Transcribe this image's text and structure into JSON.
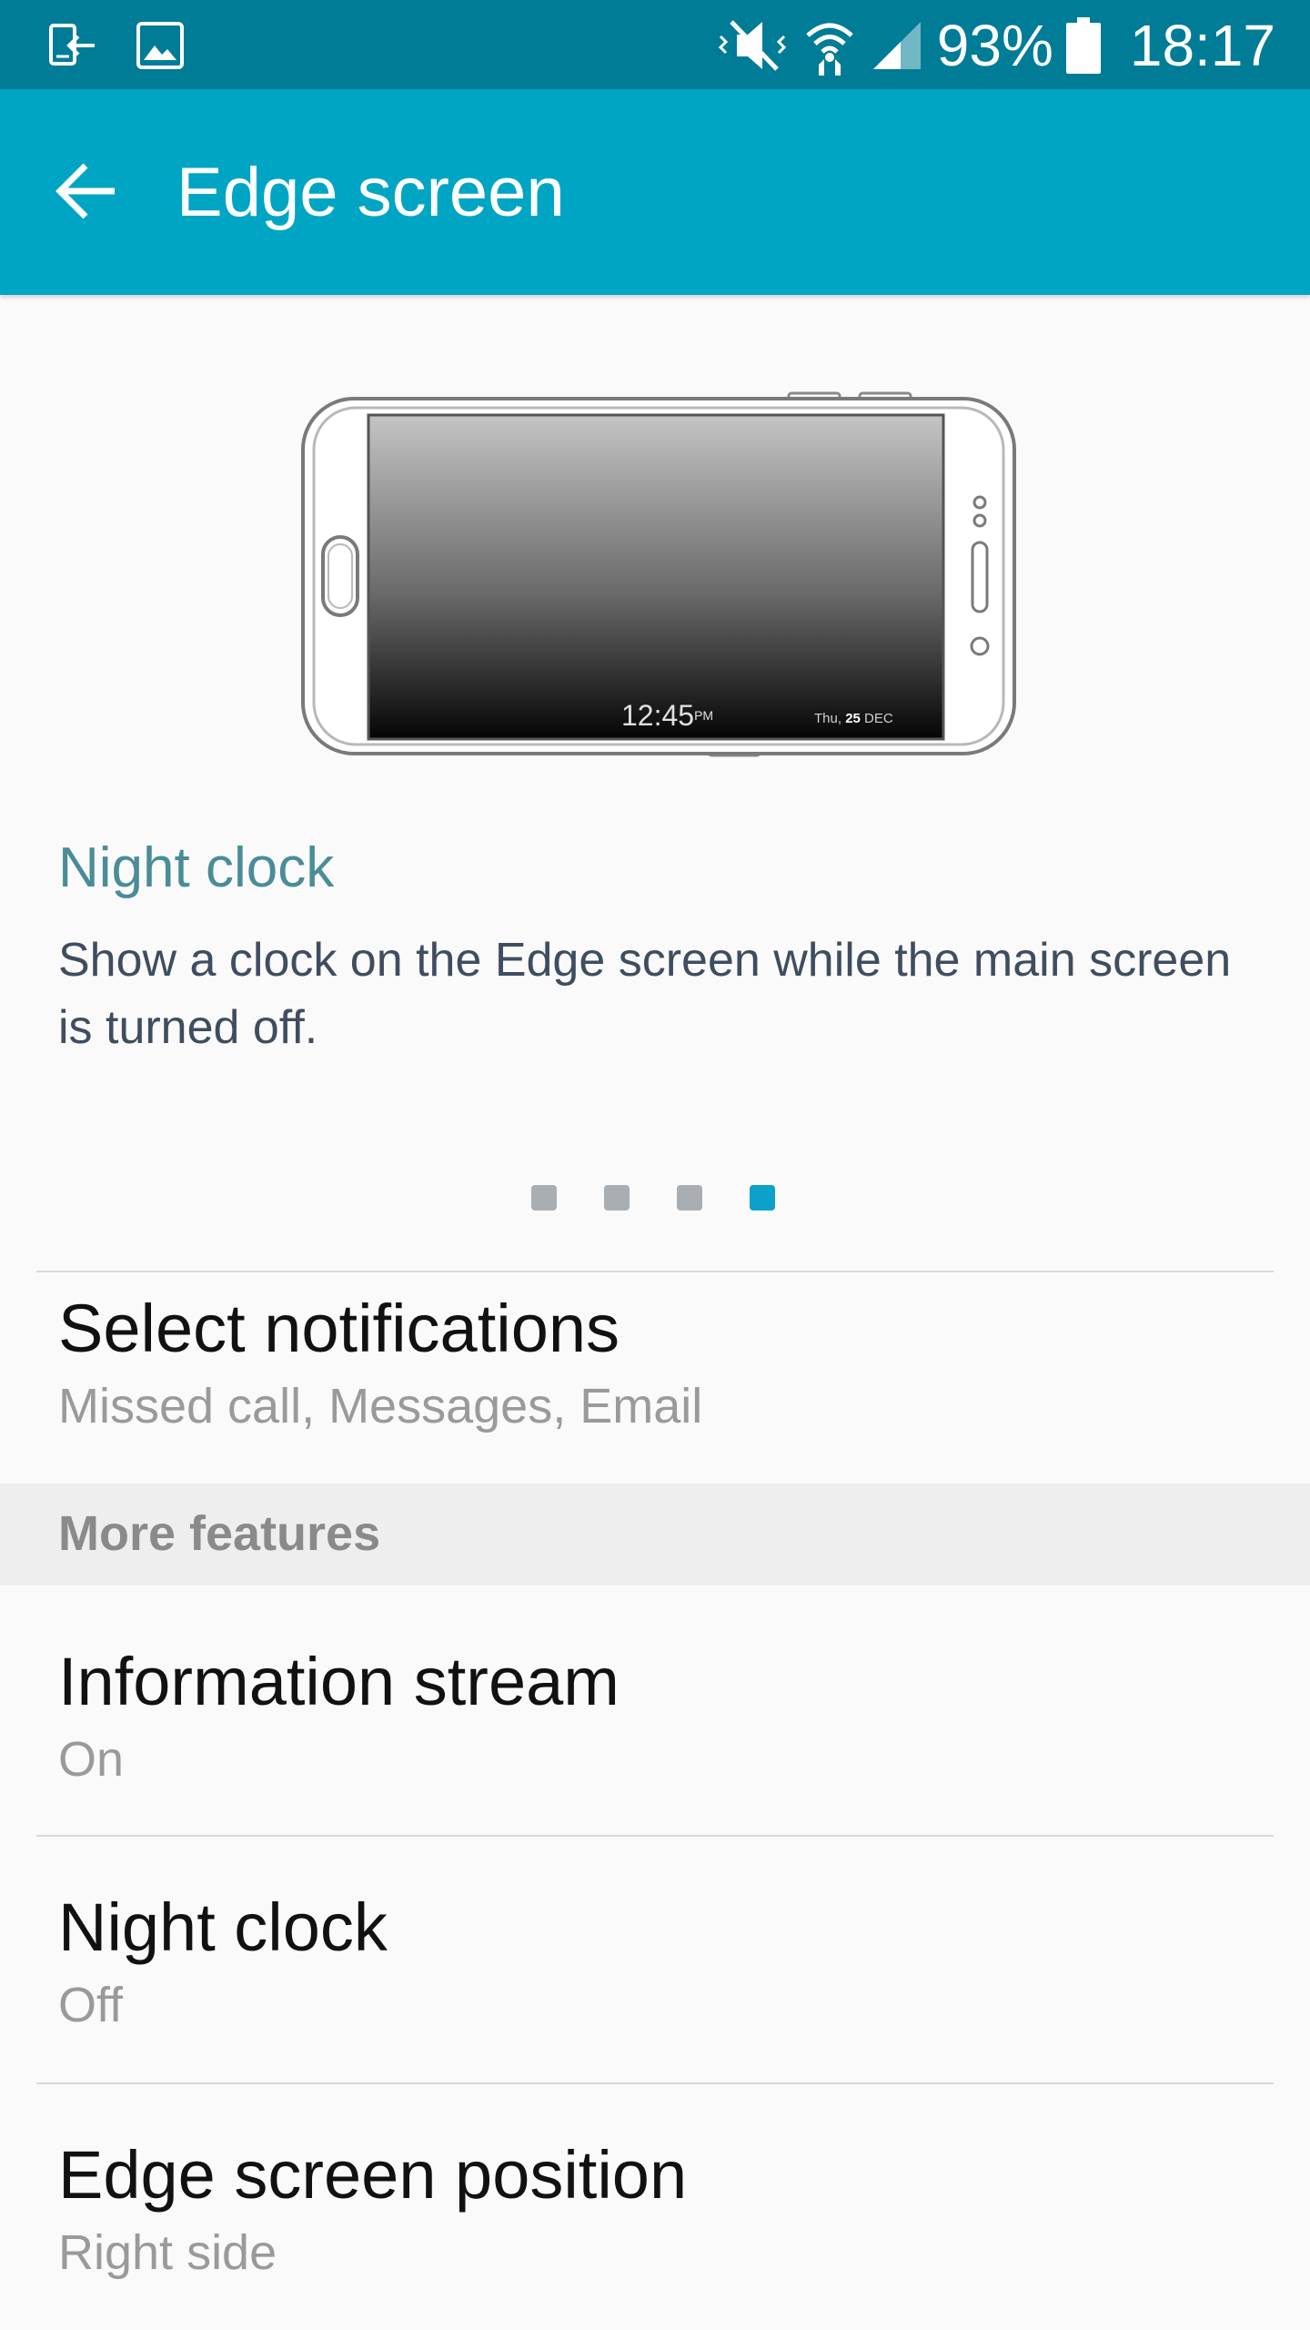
{
  "status_bar": {
    "battery": "93%",
    "time": "18:17",
    "icons": [
      "screen-mirror-icon",
      "image-icon",
      "mute-icon",
      "wifi-icon",
      "signal-icon",
      "battery-icon"
    ]
  },
  "app_bar": {
    "title": "Edge screen",
    "back_icon": "back-arrow-icon"
  },
  "illustration": {
    "clock_time": "12:45",
    "clock_ampm": "PM",
    "clock_date_prefix": "Thu,",
    "clock_date_day": "25",
    "clock_date_month": "DEC"
  },
  "feature": {
    "title": "Night clock",
    "description": "Show a clock on the Edge screen while the main screen is turned off."
  },
  "pager": {
    "total": 4,
    "active_index": 3,
    "active_color": "#0da0cb",
    "inactive_color": "#a9aeb2"
  },
  "settings": {
    "select_notifications": {
      "title": "Select notifications",
      "subtitle": "Missed call, Messages, Email"
    },
    "section_more": "More features",
    "information_stream": {
      "title": "Information stream",
      "subtitle": "On"
    },
    "night_clock": {
      "title": "Night clock",
      "subtitle": "Off"
    },
    "edge_position": {
      "title": "Edge screen position",
      "subtitle": "Right side"
    }
  },
  "colors": {
    "status_bar": "#007c96",
    "app_bar": "#00a5c4",
    "feature_title": "#4a8c98"
  }
}
